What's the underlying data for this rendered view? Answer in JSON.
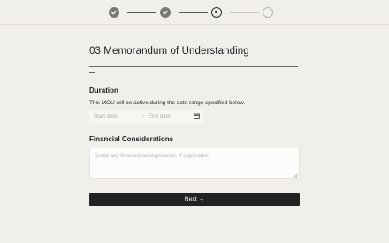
{
  "stepper": {
    "steps": [
      {
        "state": "completed",
        "icon": "check-icon"
      },
      {
        "state": "completed",
        "icon": "check-icon"
      },
      {
        "state": "current",
        "icon": "dot-icon"
      },
      {
        "state": "upcoming",
        "icon": ""
      }
    ]
  },
  "page": {
    "title": "03 Memorandum of Understanding"
  },
  "duration": {
    "label": "Duration",
    "description": "This MOU will be active during the date range specified below.",
    "start_placeholder": "Start date",
    "separator": "→",
    "end_placeholder": "End date",
    "icon": "calendar-icon"
  },
  "financial": {
    "label": "Financial Considerations",
    "placeholder": "Detail any financial arrangements, if applicable."
  },
  "actions": {
    "next_label": "Next",
    "next_icon": "→"
  },
  "colors": {
    "background": "#f1efea",
    "button": "#232220",
    "button_text": "#ffffff"
  }
}
